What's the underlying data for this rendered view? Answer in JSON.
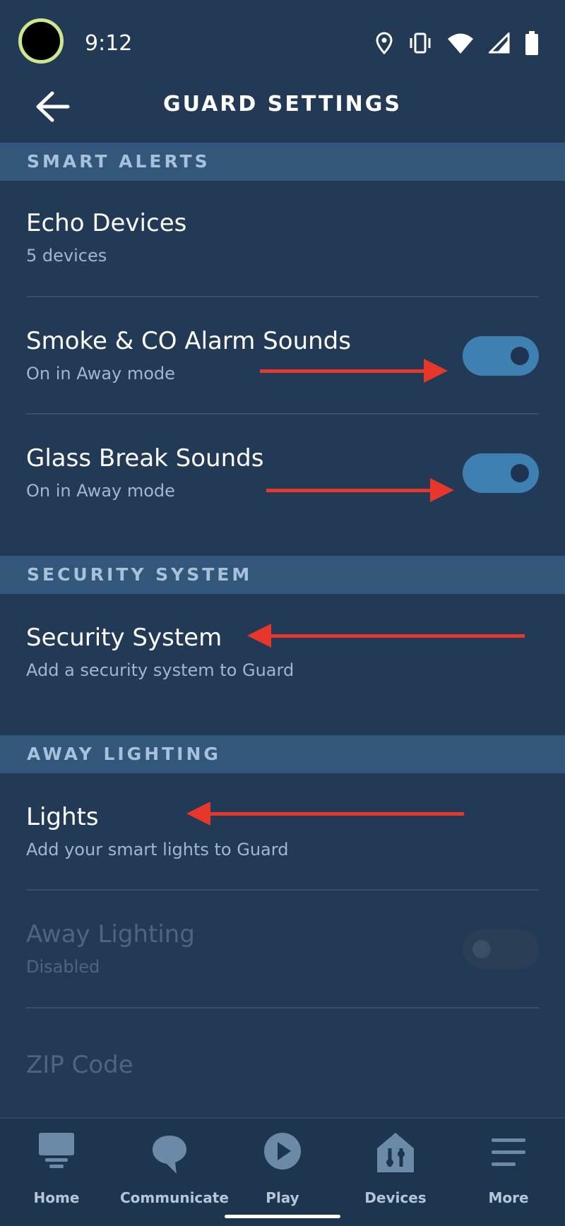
{
  "status_bar": {
    "time": "9:12"
  },
  "header": {
    "title": "GUARD SETTINGS"
  },
  "sections": {
    "smart_alerts": "SMART ALERTS",
    "security_system": "SECURITY SYSTEM",
    "away_lighting": "AWAY LIGHTING"
  },
  "rows": {
    "echo_devices": {
      "title": "Echo Devices",
      "subtitle": "5 devices"
    },
    "smoke_co": {
      "title": "Smoke & CO Alarm Sounds",
      "subtitle": "On in Away mode",
      "enabled": true
    },
    "glass_break": {
      "title": "Glass Break Sounds",
      "subtitle": "On in Away mode",
      "enabled": true
    },
    "security": {
      "title": "Security System",
      "subtitle": "Add a security system to Guard"
    },
    "lights": {
      "title": "Lights",
      "subtitle": "Add your smart lights to Guard"
    },
    "away_lighting": {
      "title": "Away Lighting",
      "subtitle": "Disabled",
      "enabled": false
    },
    "zip": {
      "title": "ZIP Code"
    }
  },
  "bottom_nav": [
    {
      "label": "Home",
      "icon": "home-icon"
    },
    {
      "label": "Communicate",
      "icon": "chat-bubble-icon"
    },
    {
      "label": "Play",
      "icon": "play-icon"
    },
    {
      "label": "Devices",
      "icon": "devices-icon"
    },
    {
      "label": "More",
      "icon": "menu-icon"
    }
  ],
  "colors": {
    "background": "#223a55",
    "section_bar": "#33577a",
    "toggle_on": "#3f80b3",
    "annotation_arrow": "#e7362a"
  }
}
